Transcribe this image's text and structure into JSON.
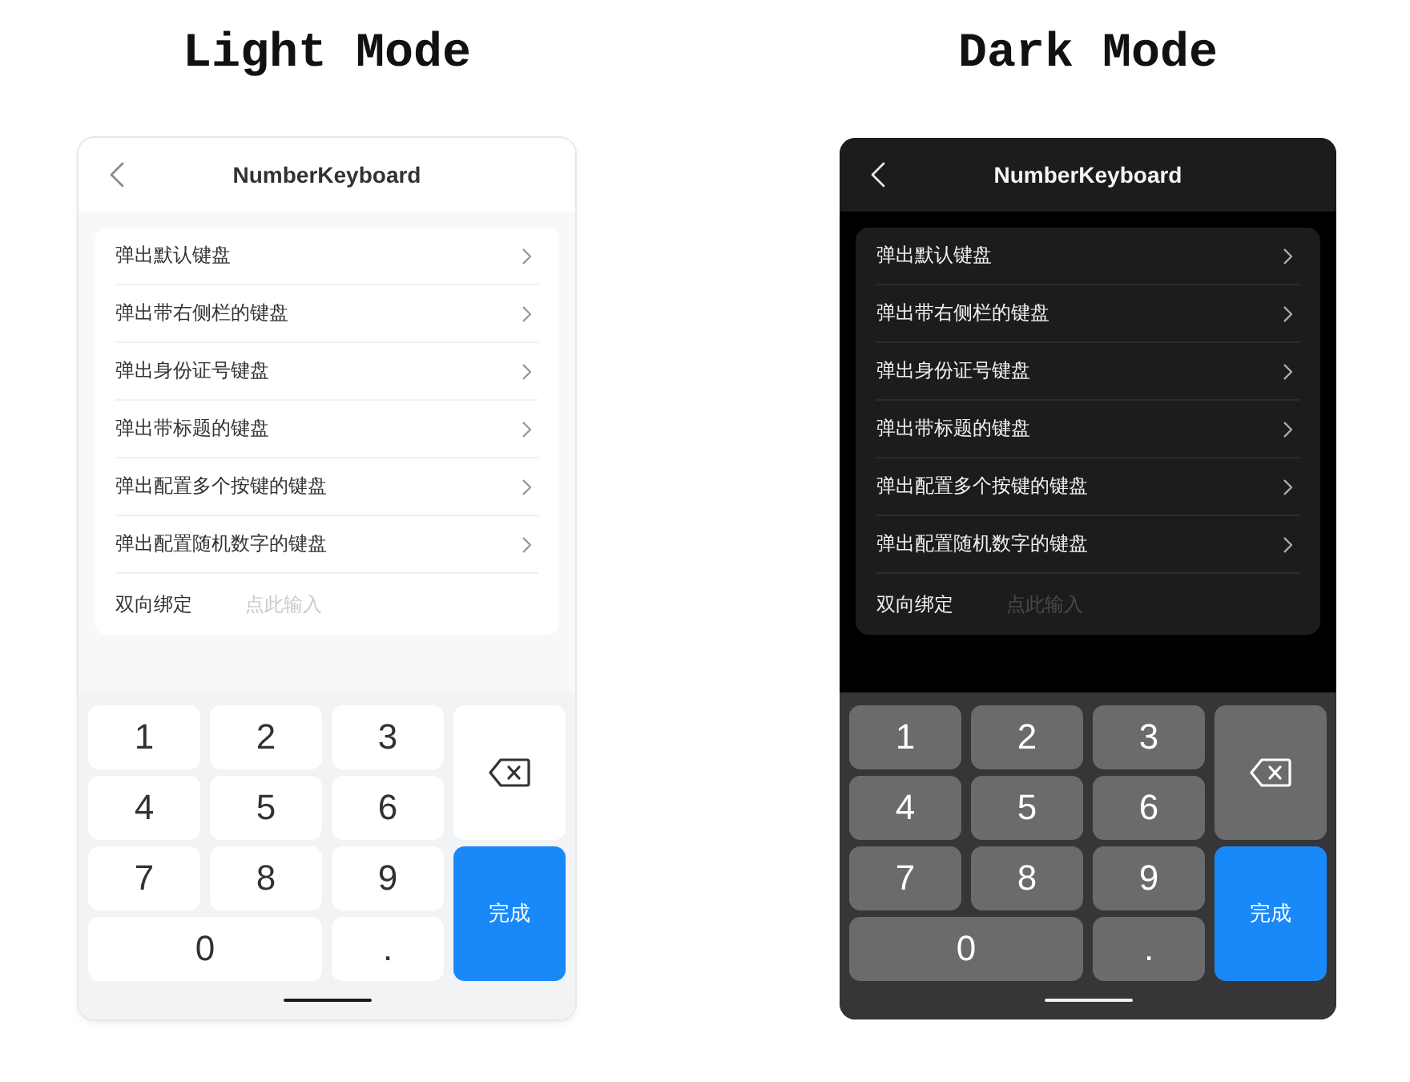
{
  "panels": [
    {
      "heading": "Light Mode",
      "dark": false,
      "nav_title": "NumberKeyboard",
      "menu_items": [
        "弹出默认键盘",
        "弹出带右侧栏的键盘",
        "弹出身份证号键盘",
        "弹出带标题的键盘",
        "弹出配置多个按键的键盘",
        "弹出配置随机数字的键盘"
      ],
      "binding": {
        "label": "双向绑定",
        "placeholder": "点此输入"
      },
      "keys": [
        {
          "kind": "digit",
          "label": "1"
        },
        {
          "kind": "digit",
          "label": "2"
        },
        {
          "kind": "digit",
          "label": "3"
        },
        {
          "kind": "delete"
        },
        {
          "kind": "digit",
          "label": "4"
        },
        {
          "kind": "digit",
          "label": "5"
        },
        {
          "kind": "digit",
          "label": "6"
        },
        {
          "kind": "digit",
          "label": "7"
        },
        {
          "kind": "digit",
          "label": "8"
        },
        {
          "kind": "digit",
          "label": "9"
        },
        {
          "kind": "done",
          "label": "完成"
        },
        {
          "kind": "wide",
          "label": "0"
        },
        {
          "kind": "digit",
          "label": "."
        }
      ]
    },
    {
      "heading": "Dark Mode",
      "dark": true,
      "nav_title": "NumberKeyboard",
      "menu_items": [
        "弹出默认键盘",
        "弹出带右侧栏的键盘",
        "弹出身份证号键盘",
        "弹出带标题的键盘",
        "弹出配置多个按键的键盘",
        "弹出配置随机数字的键盘"
      ],
      "binding": {
        "label": "双向绑定",
        "placeholder": "点此输入"
      },
      "keys": [
        {
          "kind": "digit",
          "label": "1"
        },
        {
          "kind": "digit",
          "label": "2"
        },
        {
          "kind": "digit",
          "label": "3"
        },
        {
          "kind": "delete"
        },
        {
          "kind": "digit",
          "label": "4"
        },
        {
          "kind": "digit",
          "label": "5"
        },
        {
          "kind": "digit",
          "label": "6"
        },
        {
          "kind": "digit",
          "label": "7"
        },
        {
          "kind": "digit",
          "label": "8"
        },
        {
          "kind": "digit",
          "label": "9"
        },
        {
          "kind": "done",
          "label": "完成"
        },
        {
          "kind": "wide",
          "label": "0"
        },
        {
          "kind": "digit",
          "label": "."
        }
      ]
    }
  ]
}
